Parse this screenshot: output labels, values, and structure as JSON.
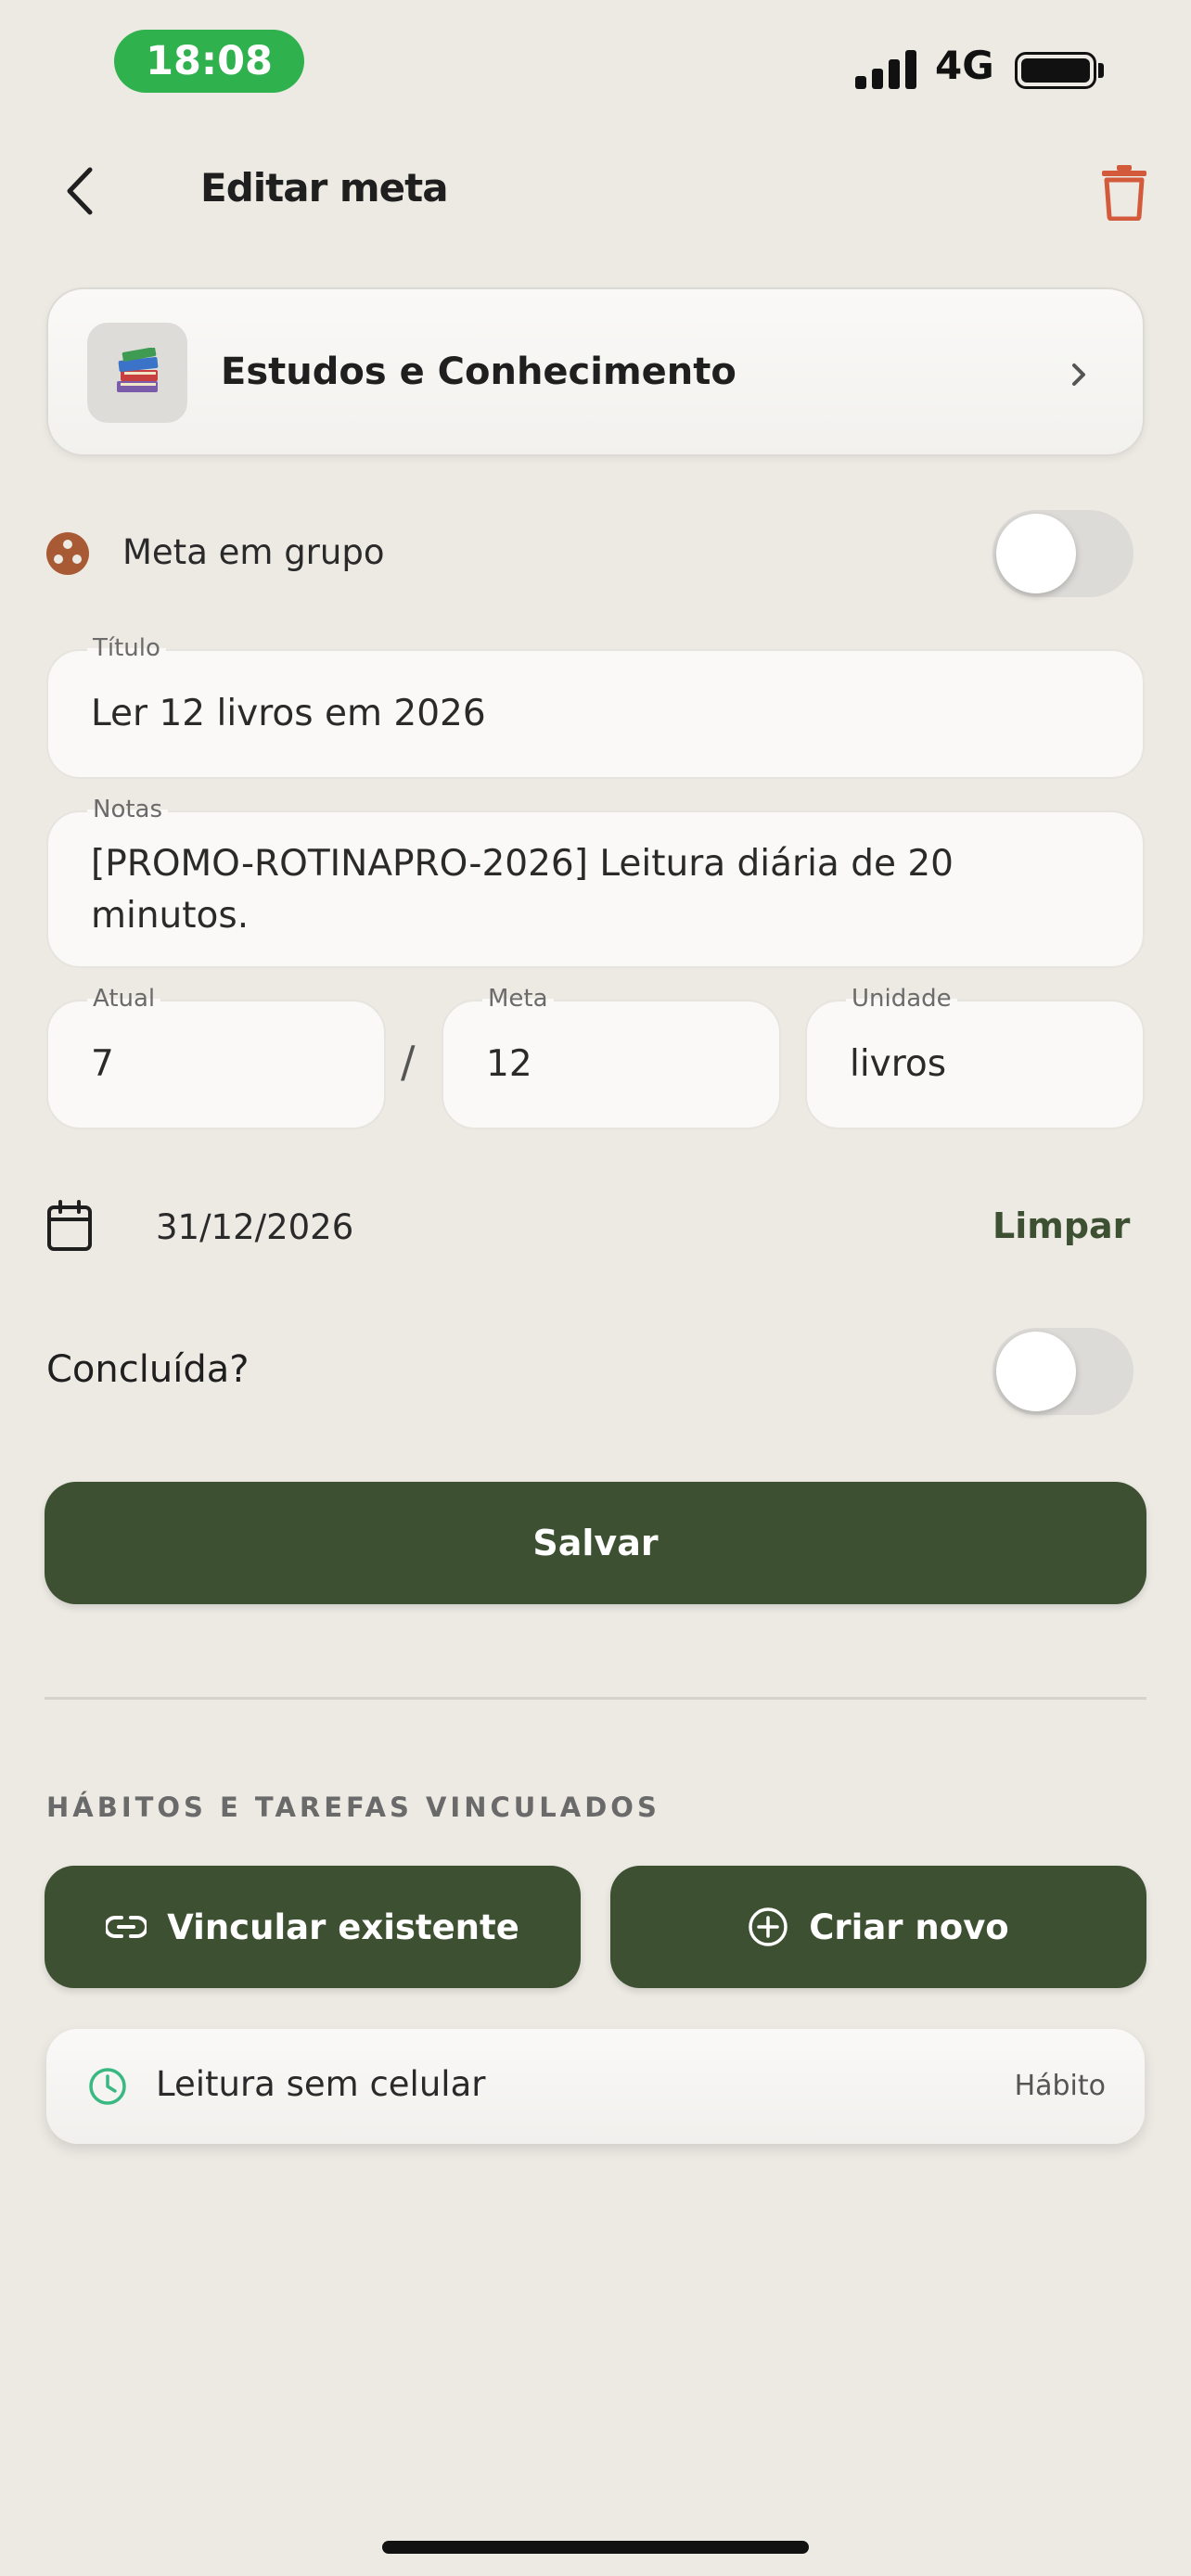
{
  "status_bar": {
    "time": "18:08",
    "network": "4G"
  },
  "header": {
    "title": "Editar meta"
  },
  "category": {
    "label": "Estudos e Conhecimento",
    "icon": "books-icon"
  },
  "group_goal": {
    "label": "Meta em grupo",
    "enabled": false
  },
  "form": {
    "title": {
      "label": "Título",
      "value": "Ler 12 livros em 2026"
    },
    "notes": {
      "label": "Notas",
      "line1": "[PROMO-ROTINAPRO-2026] Leitura diária de 20",
      "line2": "minutos."
    },
    "current": {
      "label": "Atual",
      "value": "7"
    },
    "separator": "/",
    "target": {
      "label": "Meta",
      "value": "12"
    },
    "unit": {
      "label": "Unidade",
      "value": "livros"
    }
  },
  "deadline": {
    "date": "31/12/2026",
    "clear_label": "Limpar"
  },
  "completed": {
    "label": "Concluída?",
    "enabled": false
  },
  "save_label": "Salvar",
  "linked": {
    "heading": "HÁBITOS E TAREFAS VINCULADOS",
    "link_existing_label": "Vincular existente",
    "create_new_label": "Criar novo",
    "items": [
      {
        "label": "Leitura sem celular",
        "type": "Hábito",
        "icon": "clock-icon"
      }
    ]
  },
  "colors": {
    "background": "#edeae4",
    "primary": "#3d5132",
    "danger": "#d35b3b",
    "group_icon": "#a85a34",
    "habit_icon": "#39b882",
    "status_pill": "#2fb14e"
  }
}
